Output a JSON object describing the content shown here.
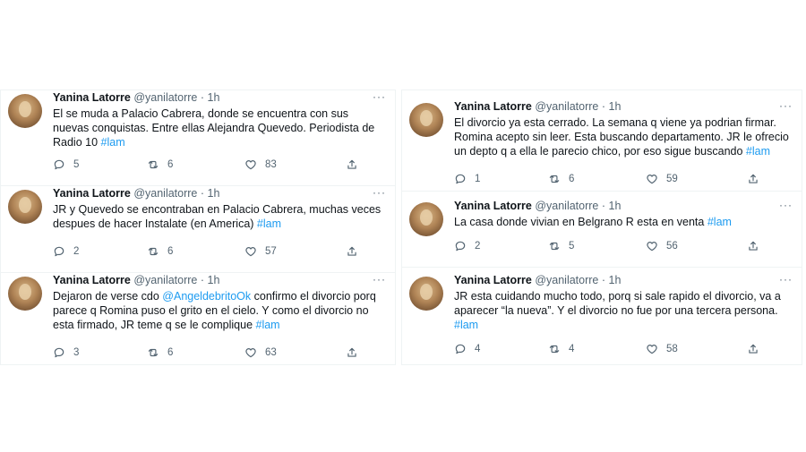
{
  "author": {
    "name": "Yanina Latorre",
    "handle": "@yanilatorre",
    "sep": "·",
    "time": "1h"
  },
  "more": "···",
  "left": [
    {
      "segments": [
        "El se muda a Palacio Cabrera, donde se encuentra con sus nuevas conquistas. Entre ellas Alejandra Quevedo. Periodista de Radio 10 ",
        "#lam",
        ""
      ],
      "replies": "5",
      "retweets": "6",
      "likes": "83"
    },
    {
      "segments": [
        "JR y Quevedo se encontraban en Palacio Cabrera, muchas veces despues de hacer Instalate (en America) ",
        "#lam",
        ""
      ],
      "replies": "2",
      "retweets": "6",
      "likes": "57"
    },
    {
      "segments": [
        "Dejaron de verse cdo ",
        "@AngeldebritoOk",
        " confirmo el divorcio porq parece q Romina puso el grito en el cielo. Y como el divorcio no esta firmado, JR teme q se le complique ",
        "#lam"
      ],
      "replies": "3",
      "retweets": "6",
      "likes": "63"
    }
  ],
  "right": [
    {
      "segments": [
        "El divorcio ya esta cerrado. La semana q viene ya podrian firmar. Romina acepto sin leer. Esta buscando departamento. JR le ofrecio un depto q a ella le parecio chico, por eso sigue buscando ",
        "#lam",
        ""
      ],
      "replies": "1",
      "retweets": "6",
      "likes": "59"
    },
    {
      "segments": [
        "La casa donde vivian en Belgrano R esta en venta ",
        "#lam",
        ""
      ],
      "replies": "2",
      "retweets": "5",
      "likes": "56"
    },
    {
      "segments": [
        "JR esta cuidando mucho todo, porq si sale rapido el divorcio, va a aparecer “la nueva”. Y el divorcio no fue por una tercera persona. ",
        "#lam",
        ""
      ],
      "replies": "4",
      "retweets": "4",
      "likes": "58"
    }
  ],
  "colors": {
    "link": "#1d9bf0",
    "muted": "#536471",
    "text": "#0f1419"
  }
}
